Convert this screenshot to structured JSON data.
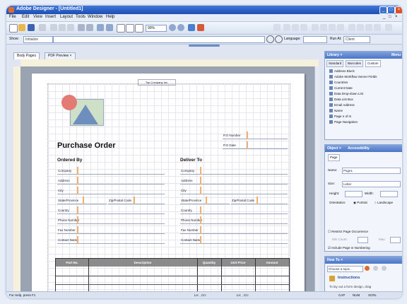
{
  "window": {
    "title": "Adobe Designer - [Untitled1]"
  },
  "menu": [
    "File",
    "Edit",
    "View",
    "Insert",
    "Layout",
    "Tools",
    "Window",
    "Help"
  ],
  "toolbar": {
    "zoom": "90%"
  },
  "toolbar2": {
    "show_label": "Show:",
    "show_value": "Initialize",
    "language_label": "Language:",
    "runat_label": "Run At:",
    "runat_value": "Client"
  },
  "tabs": [
    "Body Pages",
    "PDF Preview"
  ],
  "form": {
    "top_label": "Top Company Inc.",
    "title": "Purchase Order",
    "po_fields": [
      "P.O Number",
      "P.O Date"
    ],
    "ordered_by": {
      "heading": "Ordered By",
      "fields": [
        "Company",
        "Address",
        "City",
        "State/Province",
        "Zip/Postal Code",
        "Country",
        "Phone Number",
        "Fax Number",
        "Contact Name"
      ]
    },
    "deliver_to": {
      "heading": "Deliver To",
      "fields": [
        "Company",
        "Address",
        "City",
        "State/Province",
        "Zip/Postal Code",
        "Country",
        "Phone Number",
        "Fax Number",
        "Contact Name"
      ]
    },
    "table_headers": [
      "Part No.",
      "Description",
      "Quantity",
      "Unit Price",
      "Amount"
    ]
  },
  "library": {
    "title": "Library",
    "tabs": [
      "Standard",
      "Barcodes",
      "Custom"
    ],
    "items": [
      "Address Block",
      "Adobe Workflow Server Fields",
      "Countries",
      "Current Date",
      "Data Drop-down List",
      "Data List Box",
      "Email Address",
      "Name",
      "Page n of m",
      "Page Navigation"
    ],
    "menu_label": "Menu"
  },
  "object": {
    "title": "Object",
    "tabs": [
      "Object",
      "Accessibility"
    ],
    "subtab": "Page",
    "name_label": "Name:",
    "name_value": "Page1",
    "size_label": "Size:",
    "size_value": "Letter",
    "height_label": "Height:",
    "width_label": "Width:",
    "orientation_label": "Orientation:",
    "portrait": "Portrait",
    "landscape": "Landscape",
    "restrict": "Restrict Page Occurrence",
    "min_label": "Min Count:",
    "max_label": "Max:",
    "include": "Include Page in Numbering"
  },
  "howto": {
    "title": "How To",
    "choose": "Choose a topic...",
    "heading": "Instructions",
    "body": "To lay out a form design, drag"
  },
  "status": {
    "left": "For Help, press F1",
    "pos1": "Ln: , Cn:",
    "pos2": "Ln: , Cn:",
    "mode1": "CAP",
    "mode2": "NUM",
    "mode3": "SCRL"
  }
}
